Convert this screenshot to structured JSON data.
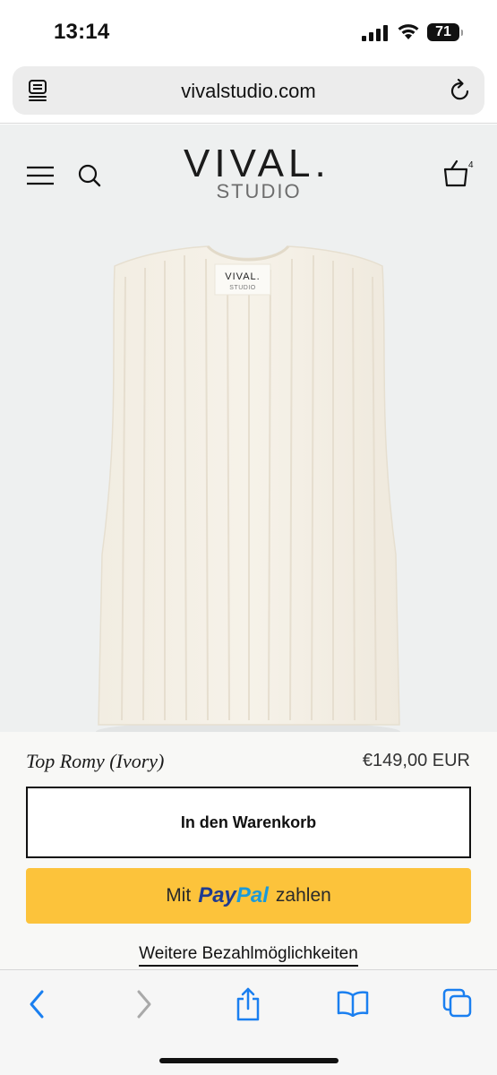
{
  "status_bar": {
    "time": "13:14",
    "battery": "71"
  },
  "browser": {
    "url": "vivalstudio.com"
  },
  "site": {
    "logo_main": "VIVAL.",
    "logo_sub": "STUDIO",
    "label_main": "VIVAL.",
    "label_sub": "STUDIO"
  },
  "product": {
    "title": "Top Romy (Ivory)",
    "price": "€149,00 EUR",
    "add_to_cart": "In den Warenkorb",
    "paypal_prefix": "Mit",
    "paypal_pay": "Pay",
    "paypal_pal": "Pal",
    "paypal_suffix": "zahlen",
    "more_payment": "Weitere Bezahlmöglichkeiten"
  },
  "colors": {
    "hero_bg": "#eef0f0",
    "paypal_yellow": "#fcc33b",
    "paypal_dark_blue": "#1f3b8f",
    "paypal_light_blue": "#1b9ad9",
    "toolbar_blue": "#1a7ff0"
  },
  "icons": {
    "toolbar": [
      "back-icon",
      "forward-icon",
      "share-icon",
      "bookmarks-icon",
      "tabs-icon"
    ]
  }
}
